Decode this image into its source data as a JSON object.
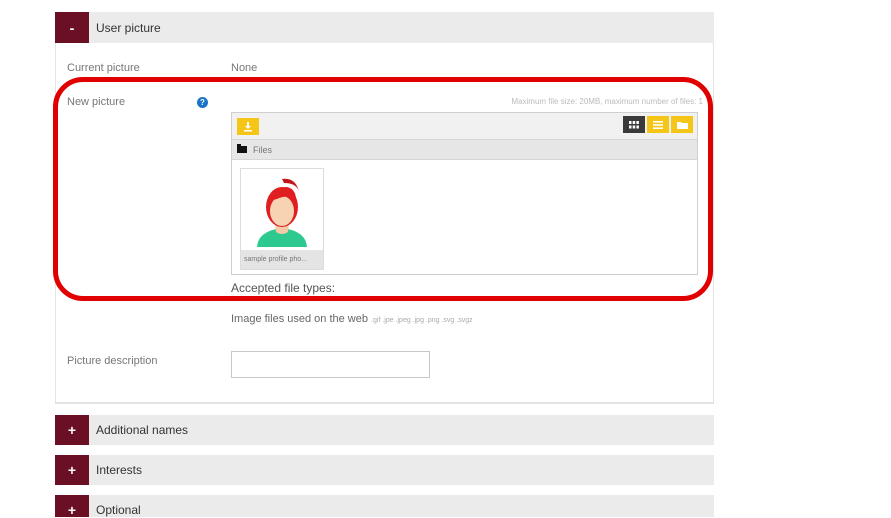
{
  "user_picture": {
    "toggle_symbol": "-",
    "title": "User picture",
    "current_picture_label": "Current picture",
    "current_picture_value": "None",
    "new_picture_label": "New picture",
    "help_symbol": "?",
    "max_info": "Maximum file size: 20MB, maximum number of files: 1",
    "filepicker": {
      "path_label": "Files",
      "file_name": "sample profile pho...",
      "toolbar_icons": [
        "download-icon",
        "grid-view-icon",
        "list-view-icon",
        "folder-view-icon"
      ]
    },
    "accepted_label": "Accepted file types:",
    "accepted_main": "Image files used on the web",
    "accepted_types": ".gif .jpe .jpeg .jpg .png .svg .svgz",
    "description_label": "Picture description",
    "description_value": ""
  },
  "sections": [
    {
      "toggle_symbol": "+",
      "title": "Additional names"
    },
    {
      "toggle_symbol": "+",
      "title": "Interests"
    },
    {
      "toggle_symbol": "+",
      "title": "Optional"
    }
  ],
  "colors": {
    "toggle_bg": "#6b0f24",
    "header_bg": "#ebebeb",
    "accent_yellow": "#f5c518",
    "dark_button": "#3a3a3a",
    "highlight_red": "#e00000",
    "help_blue": "#1a73c8"
  }
}
